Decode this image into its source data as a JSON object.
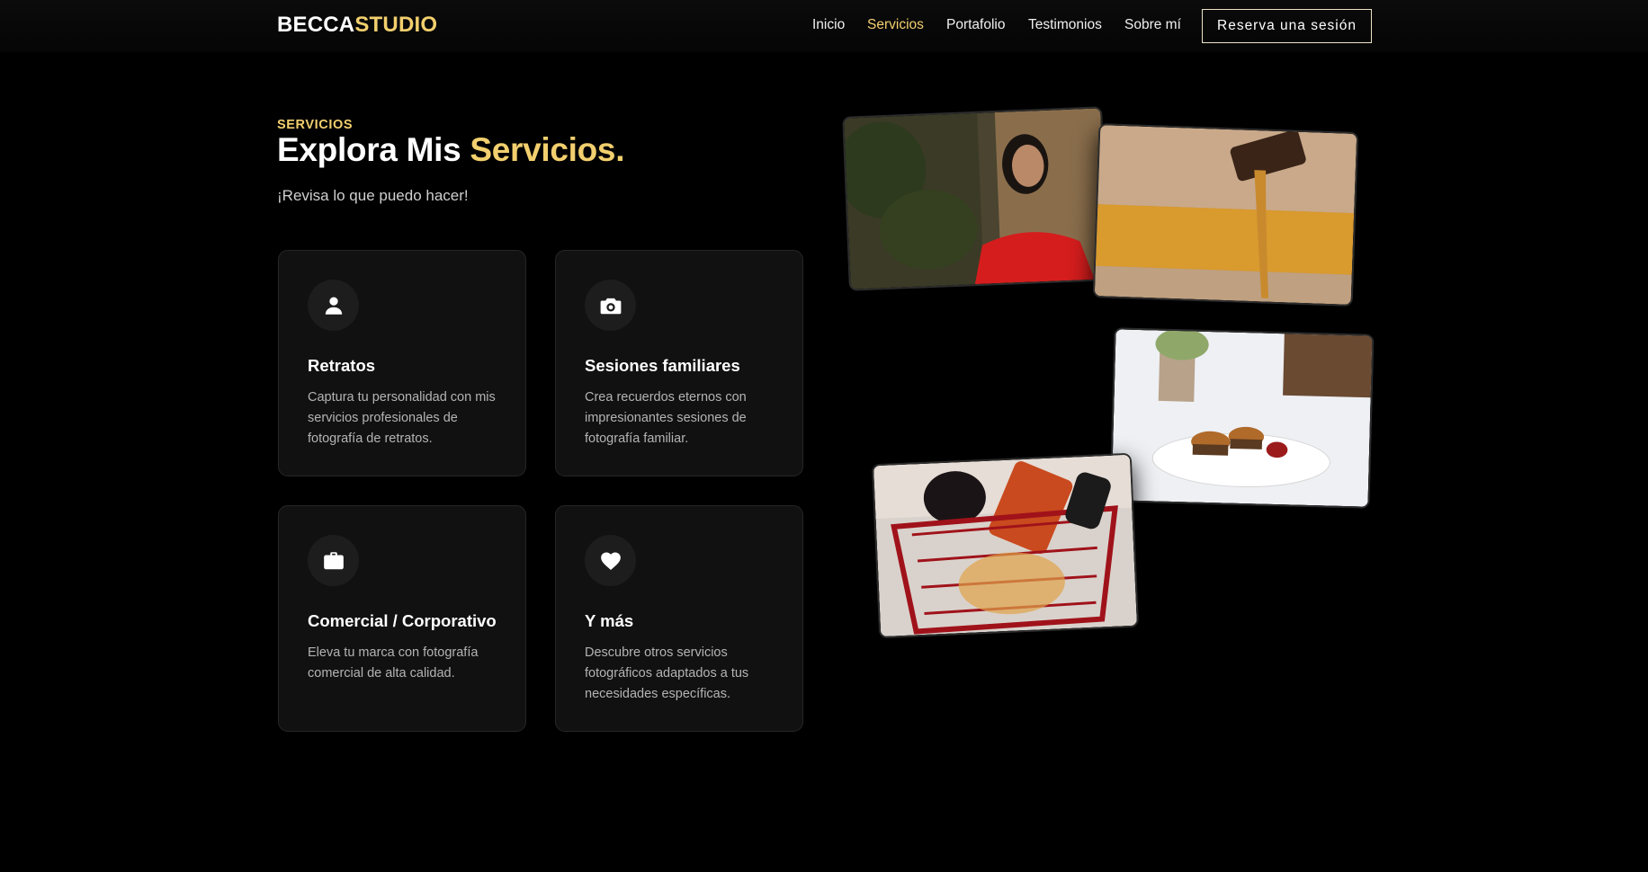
{
  "brand": {
    "part1": "BECCA",
    "part2": "STUDIO"
  },
  "nav": {
    "links": [
      {
        "label": "Inicio"
      },
      {
        "label": "Servicios",
        "active": true
      },
      {
        "label": "Portafolio"
      },
      {
        "label": "Testimonios"
      },
      {
        "label": "Sobre mí"
      }
    ],
    "cta": "Reserva una sesión"
  },
  "hero": {
    "eyebrow": "SERVICIOS",
    "title_main": "Explora Mis ",
    "title_highlight": "Servicios.",
    "subtitle": "¡Revisa lo que puedo hacer!"
  },
  "services": [
    {
      "icon": "person-icon",
      "title": "Retratos",
      "description": "Captura tu personalidad con mis servicios profesionales de fotografía de retratos."
    },
    {
      "icon": "camera-icon",
      "title": "Sesiones familiares",
      "description": "Crea recuerdos eternos con impresionantes sesiones de fotografía familiar."
    },
    {
      "icon": "briefcase-icon",
      "title": "Comercial / Corporativo",
      "description": "Eleva tu marca con fotografía comercial de alta calidad."
    },
    {
      "icon": "heart-icon",
      "title": "Y más",
      "description": "Descubre otros servicios fotográficos adaptados a tus necesidades específicas."
    }
  ],
  "gallery": [
    {
      "subject": "woman-in-red-portrait"
    },
    {
      "subject": "dessert-syrup-drip"
    },
    {
      "subject": "mini-burgers-plate"
    },
    {
      "subject": "woman-in-shopping-cart"
    }
  ],
  "colors": {
    "accent": "#f2cf6e",
    "background": "#000000",
    "card": "#111111"
  }
}
